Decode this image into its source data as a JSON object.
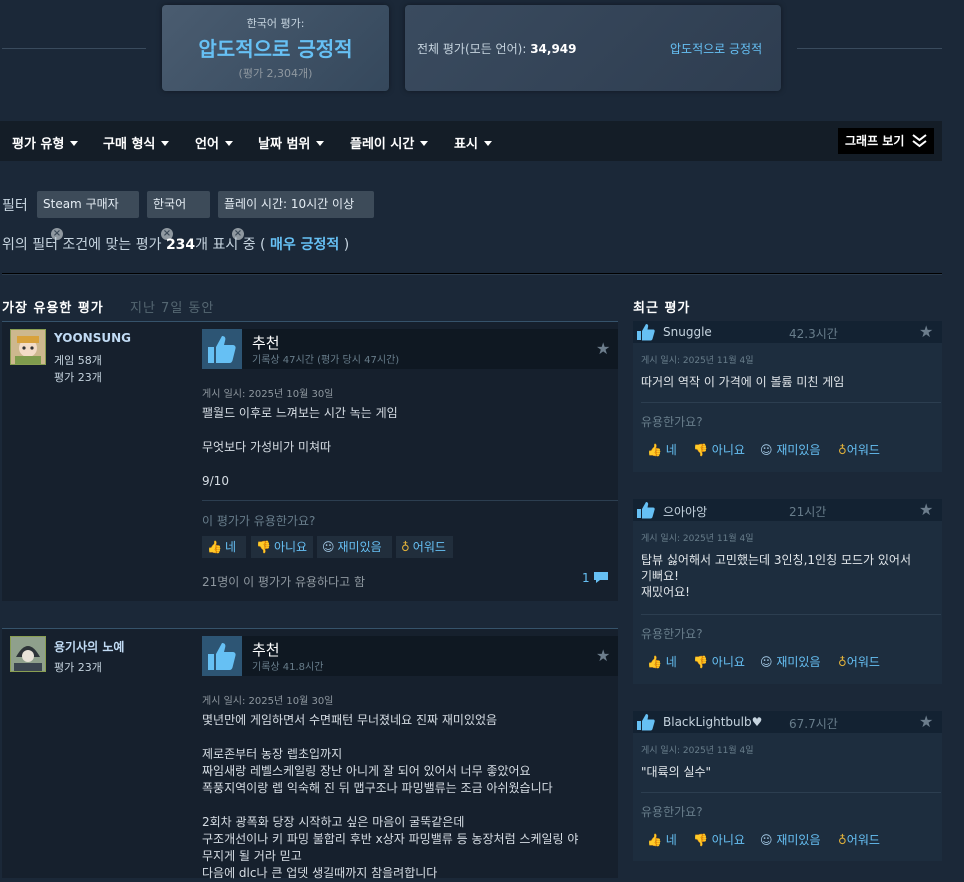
{
  "summary": {
    "korean_label": "한국어 평가:",
    "korean_rating": "압도적으로 긍정적",
    "korean_count": "(평가 2,304개)",
    "all_label": "전체 평가(모든 언어):",
    "all_count": "34,949",
    "all_rating": "압도적으로 긍정적"
  },
  "menu": {
    "items": [
      "평가 유형",
      "구매 형식",
      "언어",
      "날짜 범위",
      "플레이 시간",
      "표시"
    ],
    "graph_button": "그래프 보기"
  },
  "filters": {
    "label": "필터",
    "chips": [
      "Steam 구매자",
      "한국어",
      "플레이 시간: 10시간 이상"
    ]
  },
  "result": {
    "prefix": "위의 필터 조건에 맞는 평가",
    "count": "234",
    "middle": "개 표시 중 (",
    "rating": "매우 긍정적",
    "suffix": ")"
  },
  "sections": {
    "helpful_title": "가장 유용한 평가",
    "helpful_period": "지난 7일 동안",
    "recent_title": "최근 평가"
  },
  "reviews": [
    {
      "user": "YOONSUNG",
      "games": "게임 58개",
      "reviews": "평가 23개",
      "verdict": "추천",
      "hours": "기록상 47시간 (평가 당시 47시간)",
      "posted": "게시 일시: 2025년 10월 30일",
      "text": "팰월드 이후로 느껴보는 시간 녹는 게임\n\n무엇보다 가성비가 미쳐따\n\n9/10",
      "helpful_q": "이 평가가 유용한가요?",
      "buttons": [
        "네",
        "아니요",
        "재미있음",
        "어워드"
      ],
      "helpful_count": "21명이 이 평가가 유용하다고 함",
      "comments": "1"
    },
    {
      "user": "용기사의 노예",
      "reviews": "평가 23개",
      "verdict": "추천",
      "hours": "기록상 41.8시간",
      "posted": "게시 일시: 2025년 10월 30일",
      "text": "몇년만에 게임하면서 수면패턴 무너졌네요 진짜 재미있었음\n\n제로존부터 농장 렙초입까지\n짜임새랑 레벨스케일링 장난 아니게 잘 되어 있어서 너무 좋았어요\n폭풍지역이랑 렙 익숙해 진 뒤 맵구조나 파밍밸류는 조금 아쉬웠습니다\n\n2회차 광폭화 당장 시작하고 싶은 마음이 굴뚝같은데\n구조개선이나 키 파밍 불합리 후반 x상자 파밍밸류 등 농장처럼 스케일링 야\n무지게 될 거라 믿고\n다음에 dlc나 큰 업뎃 생길때까지 참을려합니다"
    }
  ],
  "recent": [
    {
      "user": "Snuggle",
      "hours": "42.3시간",
      "date": "게시 일시: 2025년 11월 4일",
      "text": "따거의 역작 이 가격에 이 볼륨 미친 게임",
      "helpful_q": "유용한가요?",
      "buttons": [
        "네",
        "아니요",
        "재미있음",
        "어워드"
      ]
    },
    {
      "user": "으아아앙",
      "hours": "21시간",
      "date": "게시 일시: 2025년 11월 4일",
      "text": "탑뷰 싫어해서 고민했는데 3인칭,1인칭 모드가 있어서\n기뻐요!\n재밌어요!",
      "helpful_q": "유용한가요?",
      "buttons": [
        "네",
        "아니요",
        "재미있음",
        "어워드"
      ]
    },
    {
      "user": "BlackLightbulb♥",
      "hours": "67.7시간",
      "date": "게시 일시: 2025년 11월 4일",
      "text": "\"대륙의 실수\"",
      "helpful_q": "유용한가요?",
      "buttons": [
        "네",
        "아니요",
        "재미있음",
        "어워드"
      ]
    }
  ]
}
